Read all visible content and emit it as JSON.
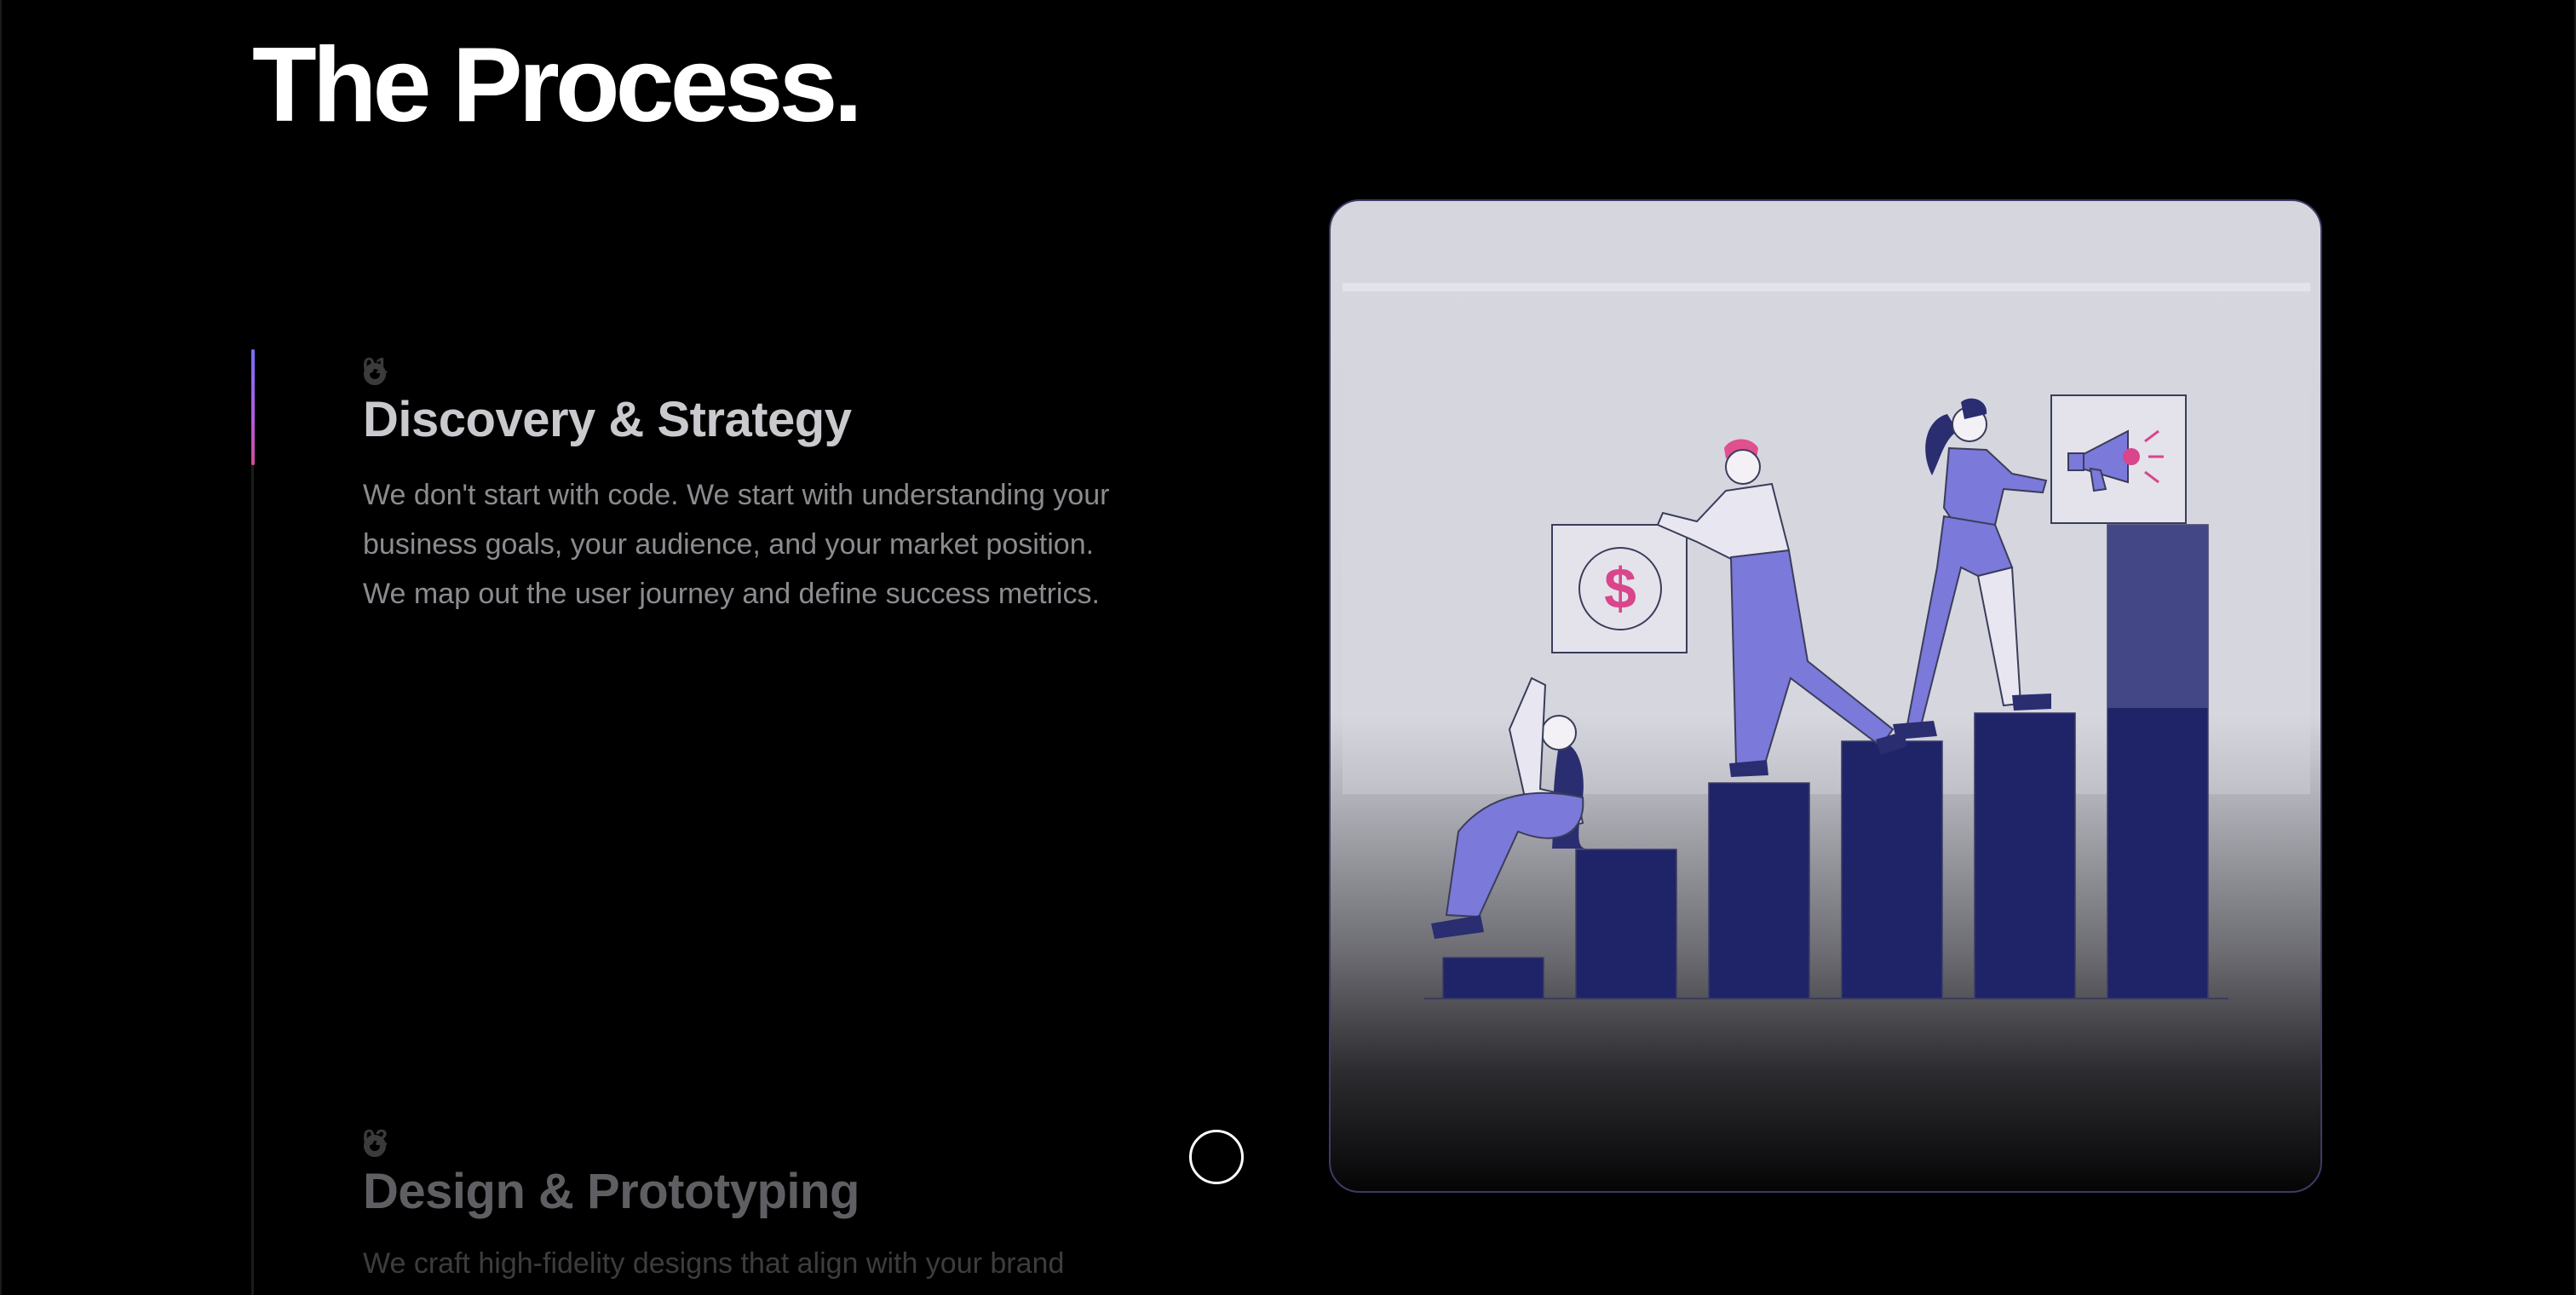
{
  "page": {
    "title": "The Process."
  },
  "steps": [
    {
      "number": "01",
      "title": "Discovery & Strategy",
      "description": "We don't start with code. We start with understanding your business goals, your audience, and your market position. We map out the user journey and define success metrics."
    },
    {
      "number": "02",
      "title": "Design & Prototyping",
      "description": "We craft high-fidelity designs that align with your brand"
    }
  ],
  "illustration": {
    "icons": [
      "dollar-icon",
      "megaphone-icon"
    ],
    "dollar_symbol": "$",
    "colors": {
      "bar": "#1f2468",
      "figure_fill": "#7b79d9",
      "accent_pink": "#d9468c",
      "card_bg": "#d6d6de"
    }
  },
  "timeline": {
    "progress_accent_start": "#7c6cff",
    "progress_accent_end": "#d04c9a"
  }
}
